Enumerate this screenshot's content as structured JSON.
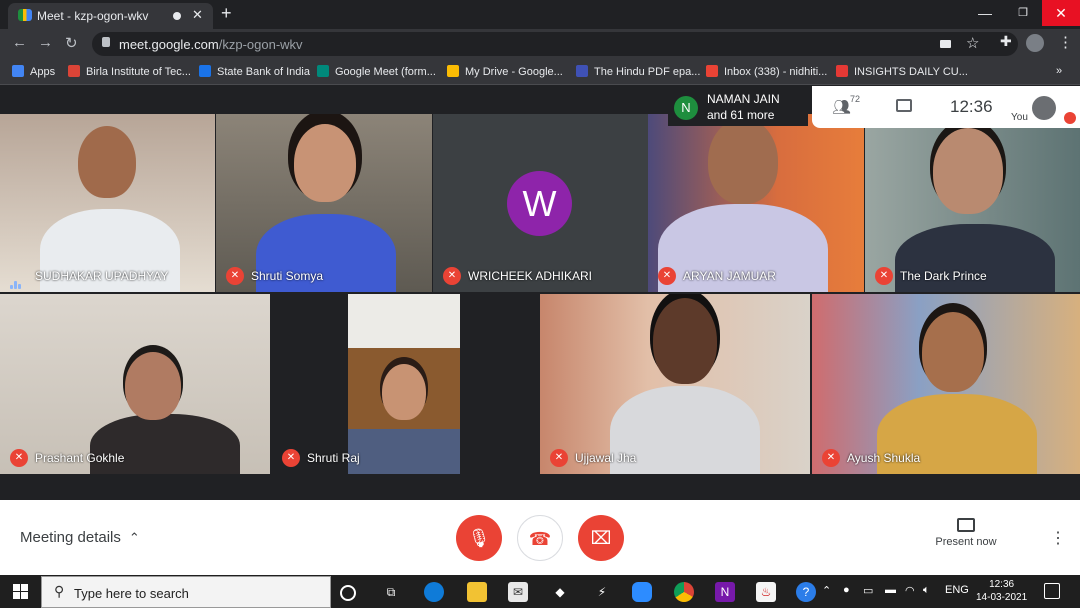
{
  "browser": {
    "tab_title": "Meet - kzp-ogon-wkv",
    "url_host": "meet.google.com",
    "url_path": "/kzp-ogon-wkv",
    "bookmarks": [
      {
        "label": "Apps",
        "color": "#4285f4"
      },
      {
        "label": "Birla Institute of Tec...",
        "color": "#db4437"
      },
      {
        "label": "State Bank of India",
        "color": "#1a73e8"
      },
      {
        "label": "Google Meet (form...",
        "color": "#00897b"
      },
      {
        "label": "My Drive - Google...",
        "color": "#fbbc04"
      },
      {
        "label": "The Hindu PDF epa...",
        "color": "#3f51b5"
      },
      {
        "label": "Inbox (338) - nidhiti...",
        "color": "#ea4335"
      },
      {
        "label": "INSIGHTS DAILY CU...",
        "color": "#e53935"
      }
    ]
  },
  "meet": {
    "participants": [
      {
        "name": "SUDHAKAR UPADHYAY",
        "speaking": true
      },
      {
        "name": "Shruti Somya",
        "muted": true
      },
      {
        "name": "WRICHEEK ADHIKARI",
        "muted": true,
        "initial": "W",
        "avatar_color": "#8e24aa"
      },
      {
        "name": "ARYAN JAMUAR",
        "muted": true
      },
      {
        "name": "The Dark Prince",
        "muted": true
      },
      {
        "name": "Prashant Gokhle",
        "muted": true
      },
      {
        "name": "Shruti Raj",
        "muted": true
      },
      {
        "name": "Ujjawal Jha",
        "muted": true
      },
      {
        "name": "Ayush Shukla",
        "muted": true
      }
    ],
    "notice": {
      "initial": "N",
      "name": "NAMAN JAIN",
      "more": "and 61 more"
    },
    "participant_count": "72",
    "time": "12:36",
    "you_label": "You",
    "meeting_details": "Meeting details",
    "present_now": "Present now"
  },
  "taskbar": {
    "search_placeholder": "Type here to search",
    "language": "ENG",
    "time": "12:36",
    "date": "14-03-2021"
  },
  "colors": {
    "accent_red": "#ea4335",
    "meet_bg": "#202124"
  }
}
